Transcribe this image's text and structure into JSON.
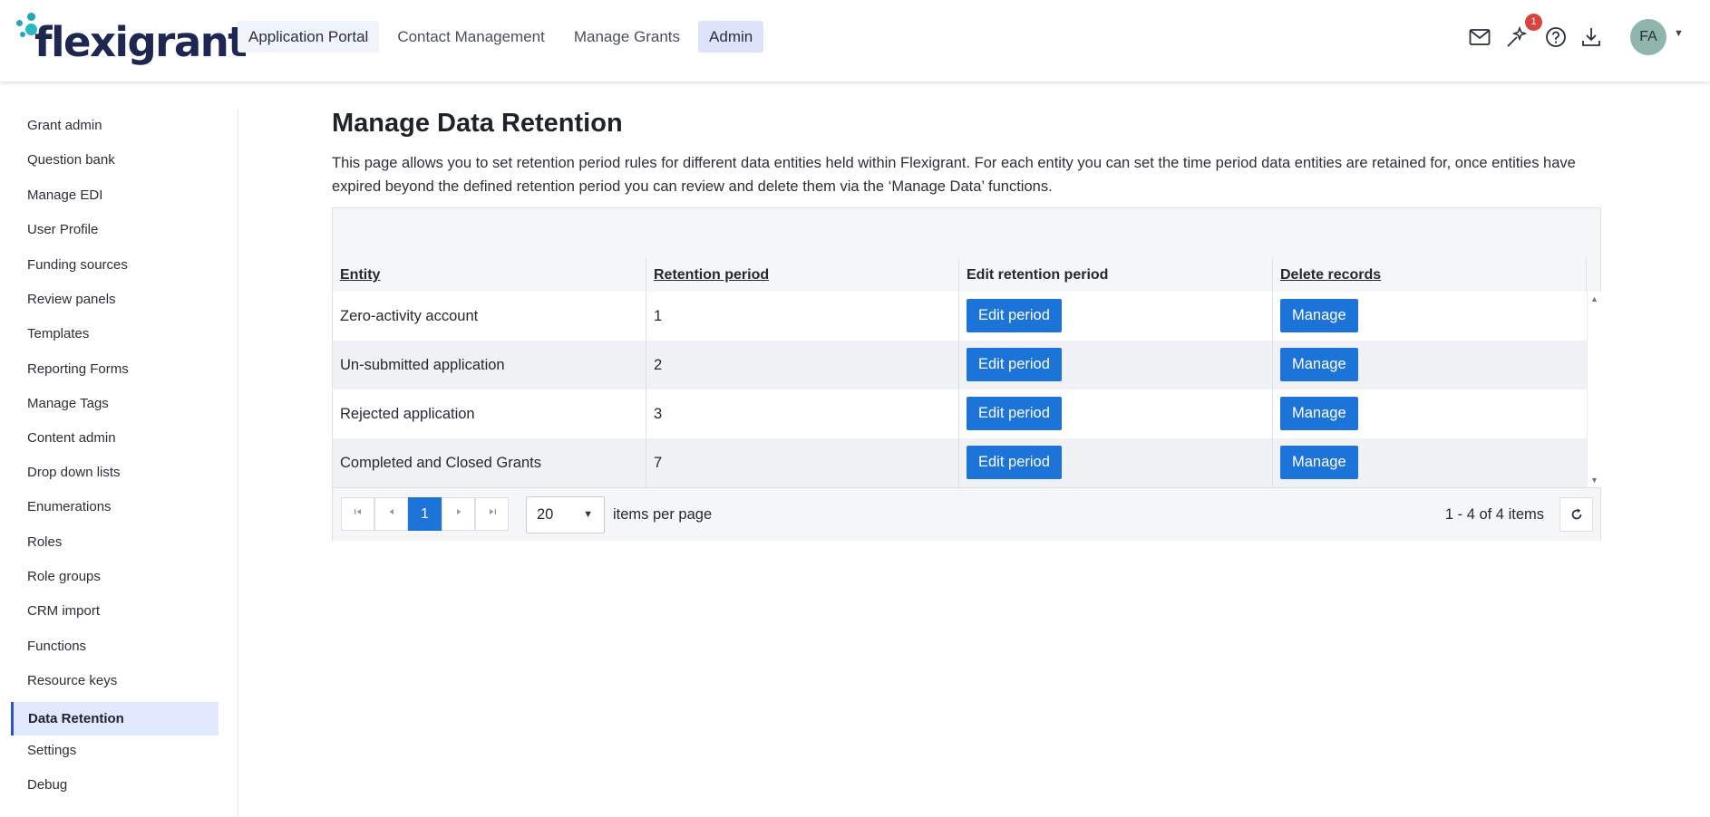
{
  "brand": {
    "name": "flexigrant",
    "logo_color": "#1d2751",
    "dot_color": "#1fa8b8"
  },
  "topnav": [
    {
      "label": "Application Portal"
    },
    {
      "label": "Contact Management"
    },
    {
      "label": "Manage Grants"
    },
    {
      "label": "Admin",
      "active": true
    }
  ],
  "header": {
    "icons": [
      "mail-icon",
      "wand-icon",
      "help-icon",
      "download-icon"
    ],
    "notification_count": "1",
    "avatar_initials": "FA"
  },
  "sidebar": {
    "items": [
      {
        "label": "Grant admin"
      },
      {
        "label": "Question bank"
      },
      {
        "label": "Manage EDI"
      },
      {
        "label": "User Profile"
      },
      {
        "label": "Funding sources"
      },
      {
        "label": "Review panels"
      },
      {
        "label": "Templates"
      },
      {
        "label": "Reporting Forms"
      },
      {
        "label": "Manage Tags"
      },
      {
        "label": "Content admin"
      },
      {
        "label": "Drop down lists"
      },
      {
        "label": "Enumerations"
      },
      {
        "label": "Roles"
      },
      {
        "label": "Role groups"
      },
      {
        "label": "CRM import"
      },
      {
        "label": "Functions"
      },
      {
        "label": "Resource keys"
      },
      {
        "label": "Data Retention",
        "active": true
      },
      {
        "label": "Settings"
      },
      {
        "label": "Debug"
      }
    ]
  },
  "main": {
    "title": "Manage Data Retention",
    "description": "This page allows you to set retention period rules for different data entities held within Flexigrant. For each entity you can set the time period data entities are retained for, once entities have expired beyond the defined retention period you can review and delete them via the ‘Manage Data’ functions."
  },
  "grid": {
    "columns": [
      "Entity",
      "Retention period",
      "Edit retention period",
      "Delete records"
    ],
    "rows": [
      {
        "entity": "Zero-activity account",
        "retention": "1",
        "edit_label": "Edit period",
        "manage_label": "Manage"
      },
      {
        "entity": "Un-submitted application",
        "retention": "2",
        "edit_label": "Edit period",
        "manage_label": "Manage"
      },
      {
        "entity": "Rejected application",
        "retention": "3",
        "edit_label": "Edit period",
        "manage_label": "Manage"
      },
      {
        "entity": "Completed and Closed Grants",
        "retention": "7",
        "edit_label": "Edit period",
        "manage_label": "Manage"
      }
    ],
    "pager": {
      "current_page": "1",
      "page_size": "20",
      "items_per_page_label": "items per page",
      "info": "1 - 4 of 4 items"
    }
  },
  "colors": {
    "accent": "#1c74d9",
    "active_nav": "#dde3fb",
    "sidebar_active": "#e2e8fd",
    "badge": "#d9453c"
  }
}
